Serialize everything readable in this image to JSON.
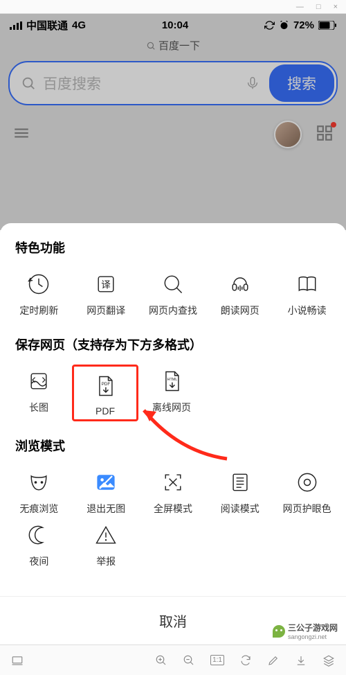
{
  "window": {
    "min": "—",
    "max": "□",
    "close": "×"
  },
  "status": {
    "carrier": "中国联通",
    "network": "4G",
    "time": "10:04",
    "battery": "72%"
  },
  "tab": {
    "title": "百度一下"
  },
  "search": {
    "placeholder": "百度搜索",
    "button": "搜索"
  },
  "sheet": {
    "section1": {
      "title": "特色功能",
      "items": [
        {
          "label": "定时刷新"
        },
        {
          "label": "网页翻译"
        },
        {
          "label": "网页内查找"
        },
        {
          "label": "朗读网页"
        },
        {
          "label": "小说畅读"
        }
      ]
    },
    "section2": {
      "title": "保存网页（支持存为下方多格式）",
      "items": [
        {
          "label": "长图"
        },
        {
          "label": "PDF"
        },
        {
          "label": "离线网页"
        }
      ]
    },
    "section3": {
      "title": "浏览模式",
      "items": [
        {
          "label": "无痕浏览"
        },
        {
          "label": "退出无图"
        },
        {
          "label": "全屏模式"
        },
        {
          "label": "阅读模式"
        },
        {
          "label": "网页护眼色"
        },
        {
          "label": "夜间"
        },
        {
          "label": "举报"
        }
      ]
    },
    "cancel": "取消"
  },
  "bottom": {
    "page": "1:1"
  },
  "watermark": {
    "text": "三公子游戏网",
    "url": "sangongzi.net"
  }
}
